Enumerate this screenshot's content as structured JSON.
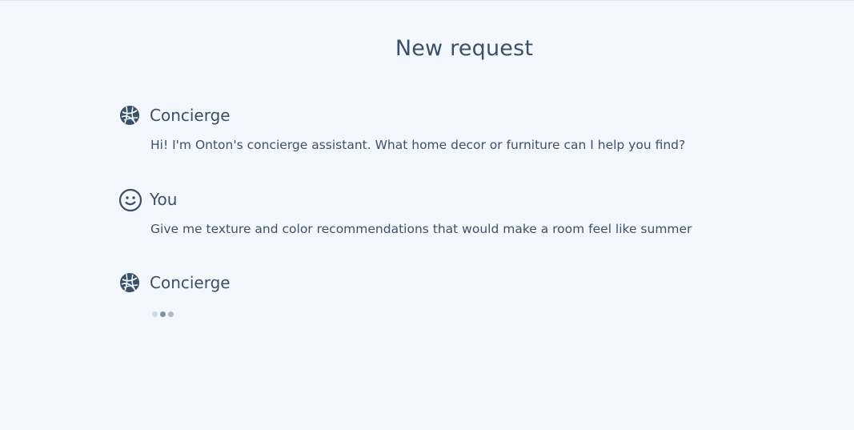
{
  "page": {
    "title": "New request"
  },
  "messages": [
    {
      "sender": "Concierge",
      "avatar_icon": "concierge-logo-icon",
      "text": "Hi! I'm Onton's concierge assistant. What home decor or furniture can I help you find?"
    },
    {
      "sender": "You",
      "avatar_icon": "smiley-face-icon",
      "text": "Give me texture and color recommendations that would make a room feel like summer"
    },
    {
      "sender": "Concierge",
      "avatar_icon": "concierge-logo-icon",
      "status": "typing"
    }
  ],
  "colors": {
    "background": "#f2f8fd",
    "text": "#3b4f69"
  }
}
